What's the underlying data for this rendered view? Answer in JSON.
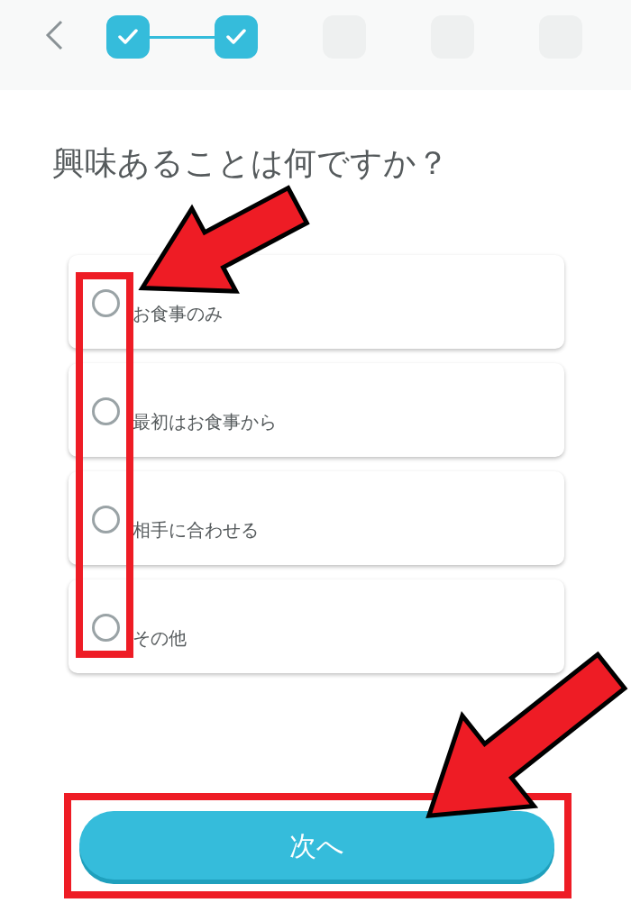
{
  "steps": [
    {
      "done": true
    },
    {
      "done": true
    },
    {
      "done": false
    },
    {
      "done": false
    },
    {
      "done": false
    }
  ],
  "title": "興味あることは何ですか？",
  "options": [
    {
      "label": "お食事のみ",
      "selected": false
    },
    {
      "label": "最初はお食事から",
      "selected": false
    },
    {
      "label": "相手に合わせる",
      "selected": false
    },
    {
      "label": "その他",
      "selected": false
    }
  ],
  "next_button": "次へ"
}
